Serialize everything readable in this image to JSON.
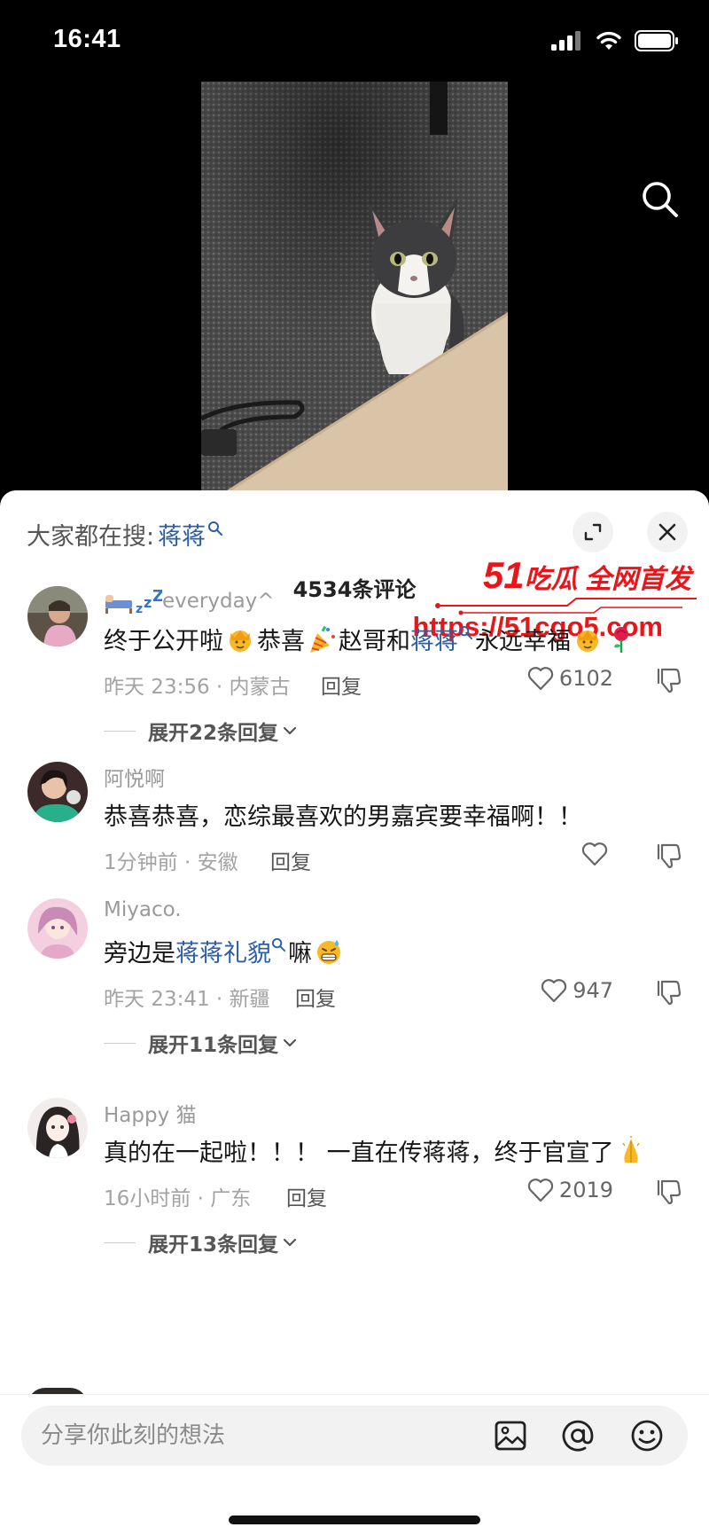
{
  "status_bar": {
    "time": "16:41"
  },
  "sheet": {
    "hot_search_label": "大家都在搜:",
    "hot_search_keyword": "蒋蒋",
    "comment_count": "4534条评论"
  },
  "watermark": {
    "brand_num": "51",
    "brand_text": "吃瓜 全网首发",
    "url": "https://51cgo5.com"
  },
  "comments": [
    {
      "username": "everyday^",
      "text_a": "终于公开啦",
      "text_b": "恭喜",
      "text_c": "赵哥和",
      "link": "蒋蒋",
      "text_d": "永远幸福",
      "time_loc": "昨天 23:56 · 内蒙古",
      "reply": "回复",
      "likes": "6102",
      "expand": "展开22条回复"
    },
    {
      "username": "阿悦啊",
      "text": "恭喜恭喜，恋综最喜欢的男嘉宾要幸福啊！！",
      "time_loc": "1分钟前 · 安徽",
      "reply": "回复",
      "likes": ""
    },
    {
      "username": "Miyaco.",
      "text_a": "旁边是",
      "link": "蒋蒋礼貌",
      "text_b": "嘛",
      "time_loc": "昨天 23:41 · 新疆",
      "reply": "回复",
      "likes": "947",
      "expand": "展开11条回复"
    },
    {
      "username": "Happy 猫",
      "text": "真的在一起啦！！！ 一直在传蒋蒋，终于官宣了",
      "time_loc": "16小时前 · 广东",
      "reply": "回复",
      "likes": "2019",
      "expand": "展开13条回复"
    }
  ],
  "input": {
    "placeholder": "分享你此刻的想法"
  },
  "icons": {
    "search": "search-icon",
    "expand": "expand-icon",
    "close": "close-icon",
    "heart": "heart-icon",
    "dislike": "dislike-icon",
    "chevron": "chevron-down-icon",
    "image": "image-icon",
    "at": "at-icon",
    "emoji": "emoji-icon"
  },
  "colors": {
    "link": "#2b5ea8",
    "watermark": "#e8161a",
    "sheet_bg": "#ffffff"
  }
}
